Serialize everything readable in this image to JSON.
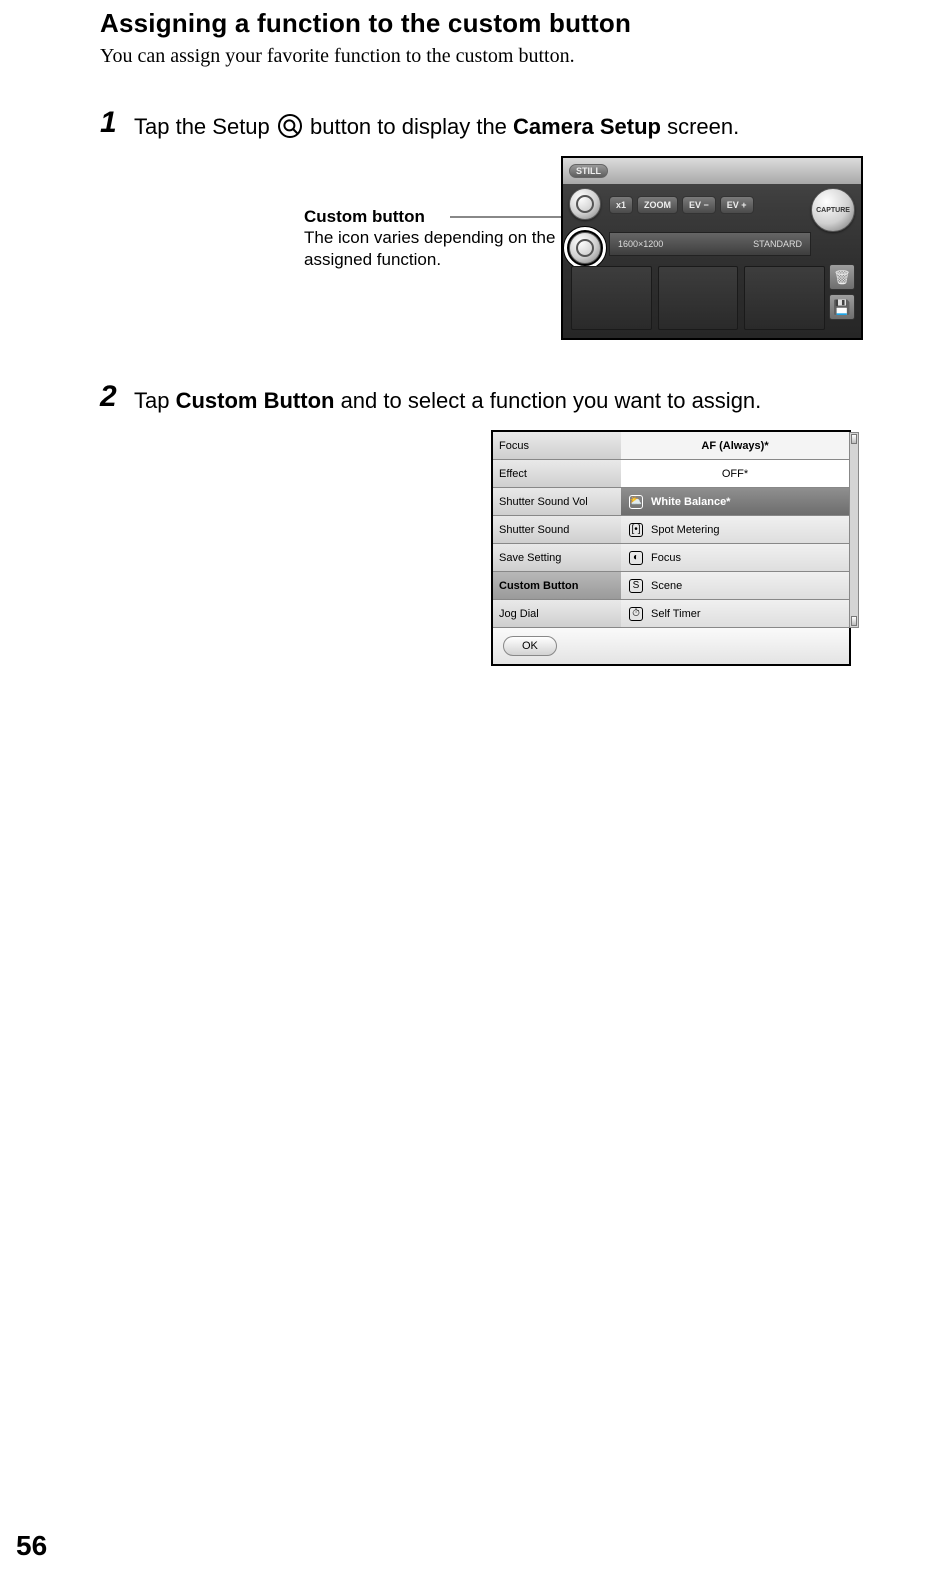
{
  "heading": "Assigning a function to the custom button",
  "lead": "You can assign your favorite function to the custom button.",
  "step1": {
    "num": "1",
    "pre": "Tap the Setup ",
    "post": " button to display the ",
    "bold": "Camera Setup",
    "tail": " screen."
  },
  "callout": {
    "label": "Custom button",
    "caption": "The icon varies depending on the assigned function."
  },
  "camshot": {
    "mode": "STILL",
    "zoom_mag": "x1",
    "zoom_label": "ZOOM",
    "ev_minus": "EV −",
    "ev_plus": "EV +",
    "capture": "CAPTURE",
    "res": "1600×1200",
    "quality": "STANDARD"
  },
  "step2": {
    "num": "2",
    "pre": "Tap ",
    "bold": "Custom Button",
    "tail": " and to select a function you want to assign."
  },
  "settings": {
    "left": [
      {
        "label": "Focus"
      },
      {
        "label": "Effect"
      },
      {
        "label": "Shutter Sound Vol"
      },
      {
        "label": "Shutter Sound"
      },
      {
        "label": "Save Setting"
      },
      {
        "label": "Custom Button",
        "selected": true
      },
      {
        "label": "Jog Dial"
      }
    ],
    "top1": "AF (Always)*",
    "top2": "OFF*",
    "options": [
      {
        "icon": "⛅",
        "label": "White Balance*",
        "selected": true
      },
      {
        "icon": "[•]",
        "label": "Spot Metering"
      },
      {
        "icon": "◐",
        "label": "Focus"
      },
      {
        "icon": "S",
        "label": "Scene"
      },
      {
        "icon": "⏱",
        "label": "Self Timer"
      }
    ],
    "ok": "OK"
  },
  "page_number": "56"
}
